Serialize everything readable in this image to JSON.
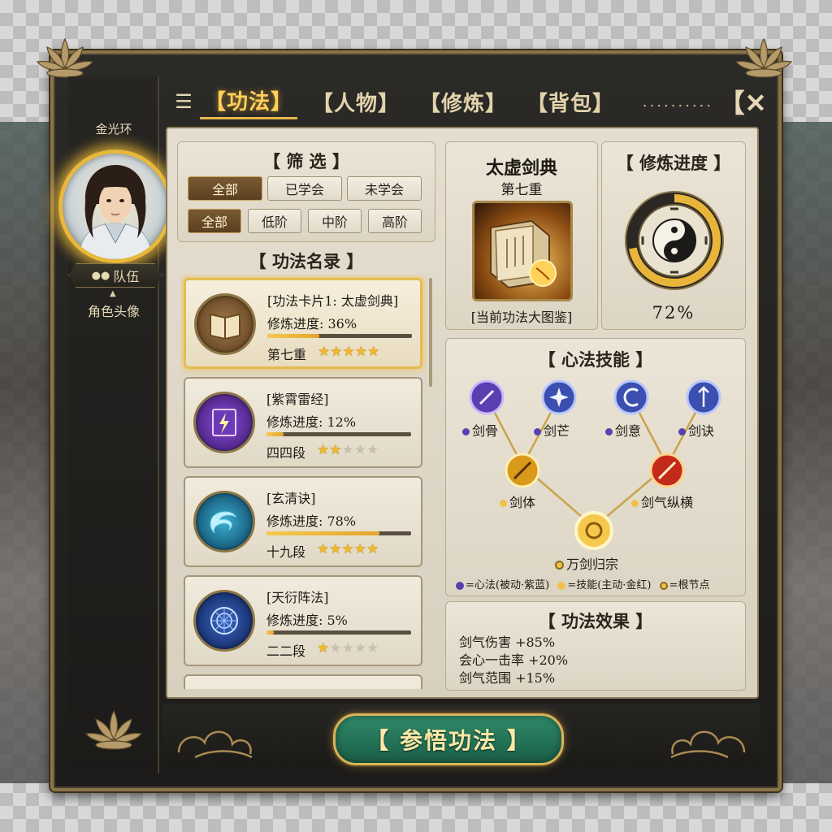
{
  "sidebar": {
    "halo_label": "金光环",
    "team_label": "队伍",
    "avatar_caption": "角色头像"
  },
  "nav": {
    "tabs": [
      "【功法】",
      "【人物】",
      "【修炼】",
      "【背包】"
    ],
    "active_tab": 0,
    "dots": "..........",
    "close_label": "【✕"
  },
  "filter": {
    "title": "【 筛 选 】",
    "row1": [
      "全部",
      "已学会",
      "未学会"
    ],
    "row2": [
      "全部",
      "低阶",
      "中阶",
      "高阶"
    ],
    "row1_active": 0,
    "row2_active": 0
  },
  "list": {
    "title": "【 功法名录 】",
    "items": [
      {
        "name": "[功法卡片1: 太虚剑典]",
        "progress_text": "修炼进度: 36%",
        "progress": 0.36,
        "level": "第七重",
        "stars": 5,
        "icon": "open-book-icon",
        "selected": true
      },
      {
        "name": "[紫霄雷经]",
        "progress_text": "修炼进度: 12%",
        "progress": 0.12,
        "level": "四四段",
        "stars": 2,
        "icon": "lightning-book-icon",
        "selected": false
      },
      {
        "name": "[玄清诀]",
        "progress_text": "修炼进度: 78%",
        "progress": 0.78,
        "level": "十九段",
        "stars": 5,
        "icon": "water-swirl-icon",
        "selected": false
      },
      {
        "name": "[天衍阵法]",
        "progress_text": "修炼进度: 5%",
        "progress": 0.05,
        "level": "二二段",
        "stars": 1,
        "icon": "array-circle-icon",
        "selected": false
      }
    ]
  },
  "current": {
    "name": "太虚剑典",
    "level": "第七重",
    "caption": "[当前功法大图鉴]"
  },
  "progress_panel": {
    "title": "【 修炼进度 】",
    "percent_text": "72%",
    "percent": 0.72
  },
  "tree": {
    "title": "【 心法技能 】",
    "passive_nodes": [
      "剑骨",
      "剑芒",
      "剑意",
      "剑诀"
    ],
    "skill_nodes": [
      "剑体",
      "剑气纵横"
    ],
    "root_node": "万剑归宗",
    "legend_passive": "=心法(被动·紫蓝)",
    "legend_skill": "=技能(主动·金红)",
    "legend_root": "=根节点"
  },
  "effects": {
    "title": "【 功法效果 】",
    "lines": [
      "剑气伤害 +85%",
      "会心一击率 +20%",
      "剑气范围 +15%"
    ]
  },
  "action": {
    "comprehend_label": "【 参悟功法 】"
  },
  "colors": {
    "gold": "#e7b64a",
    "frame": "#8a7448",
    "jade_button": "#1a5e47",
    "passive": "#5b3fb0",
    "skill": "#d99a1c"
  }
}
